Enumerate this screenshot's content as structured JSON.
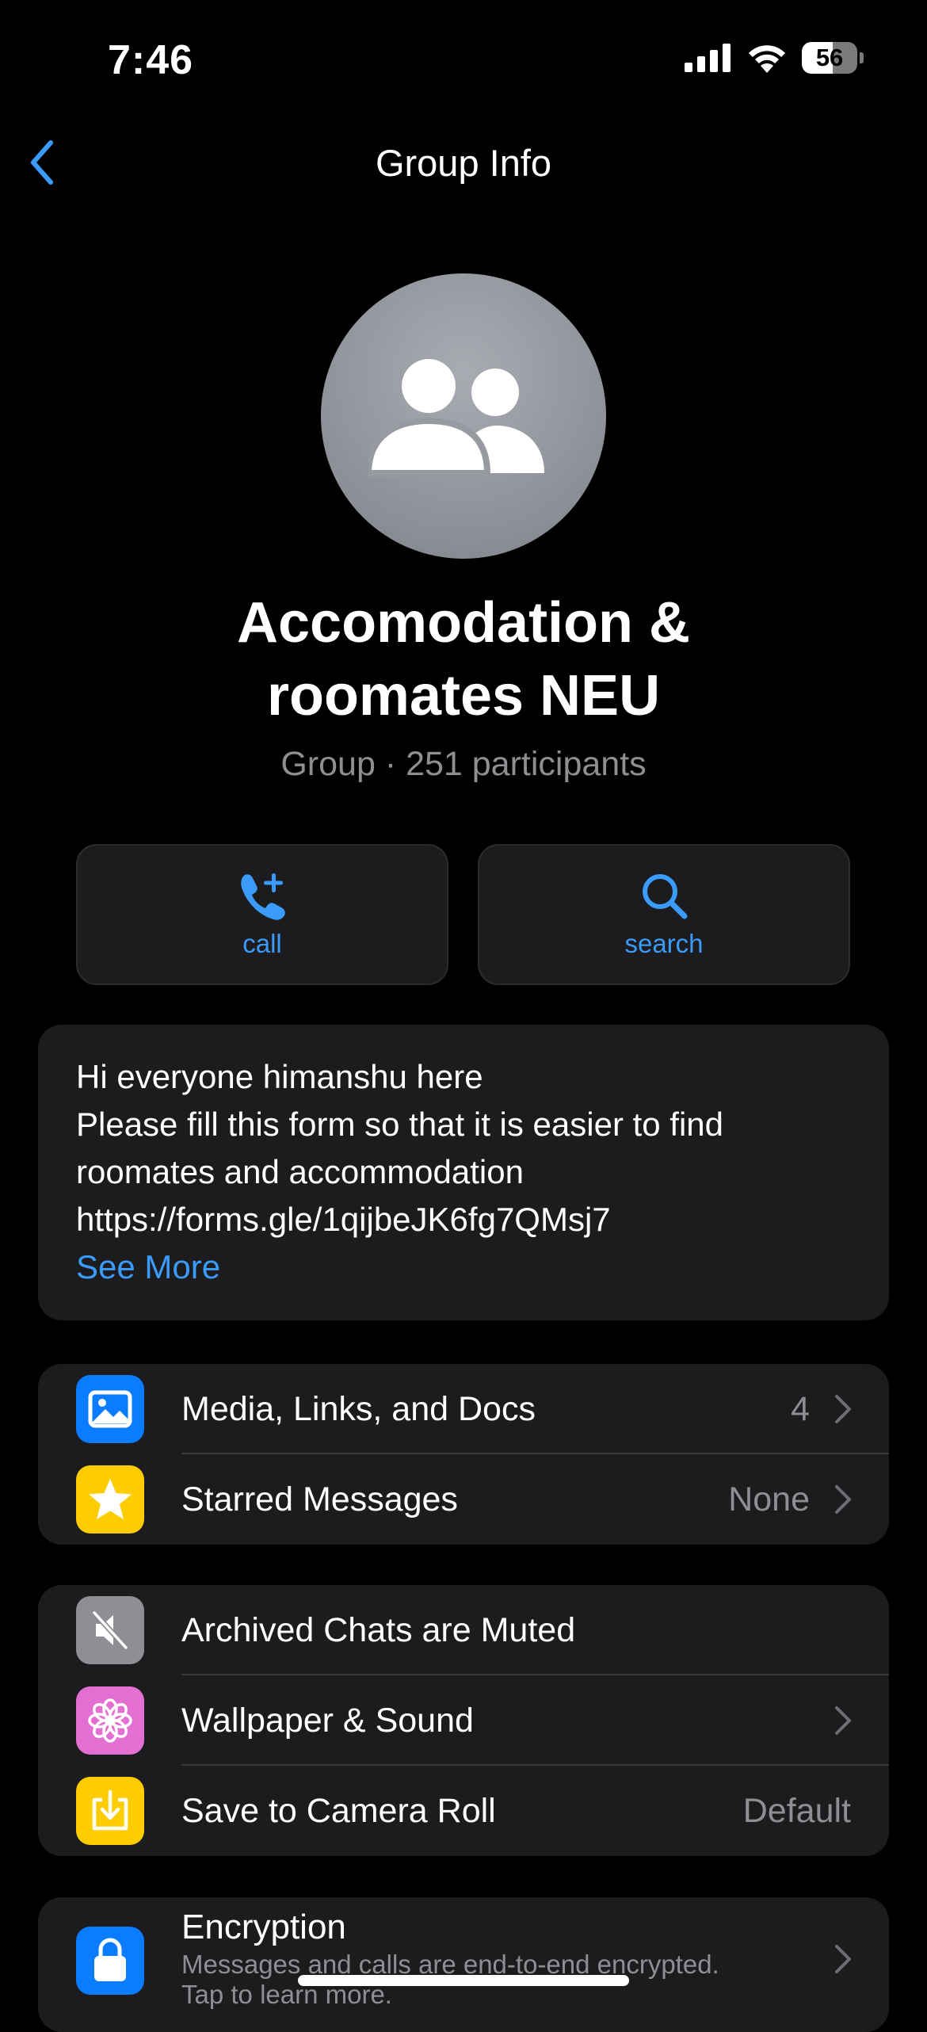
{
  "status_bar": {
    "time": "7:46",
    "battery": "56"
  },
  "nav": {
    "title": "Group Info"
  },
  "group": {
    "name_line1": "Accomodation &",
    "name_line2": "roomates NEU",
    "meta": "Group · 251 participants"
  },
  "actions": {
    "call_label": "call",
    "search_label": "search"
  },
  "description": {
    "lines": [
      "Hi everyone himanshu here",
      "Please fill this form so that it is easier to find",
      "roomates and accommodation",
      "https://forms.gle/1qijbeJK6fg7QMsj7"
    ],
    "see_more": "See More"
  },
  "media_section": {
    "rows": [
      {
        "label": "Media, Links, and Docs",
        "value": "4",
        "icon": "photo-icon",
        "color": "#0a7cff"
      },
      {
        "label": "Starred Messages",
        "value": "None",
        "icon": "star-icon",
        "color": "#ffcc00"
      }
    ]
  },
  "settings_section": {
    "rows": [
      {
        "label": "Archived Chats are Muted",
        "value": "",
        "icon": "muted-speaker-icon",
        "color": "#8e8e93"
      },
      {
        "label": "Wallpaper & Sound",
        "value": "",
        "icon": "flower-icon",
        "color": "#e36fd2"
      },
      {
        "label": "Save to Camera Roll",
        "value": "Default",
        "icon": "download-icon",
        "color": "#ffcc00"
      }
    ]
  },
  "encryption": {
    "title": "Encryption",
    "subtitle_line1": "Messages and calls are end-to-end encrypted.",
    "subtitle_line2": "Tap to learn more.",
    "icon": "lock-icon",
    "color": "#0a7cff"
  },
  "colors": {
    "accent": "#3a9bfa",
    "background": "#000000",
    "card": "#1c1c1e",
    "secondary_text": "#8e8e93"
  }
}
